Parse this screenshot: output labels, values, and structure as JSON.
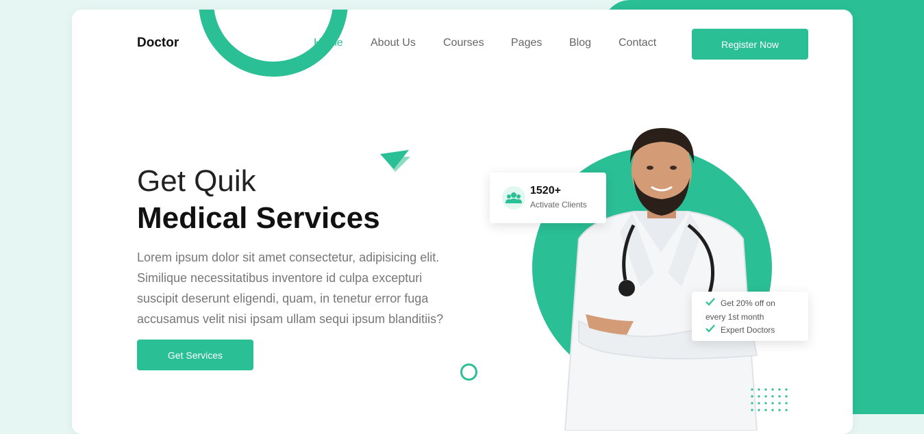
{
  "brand": {
    "logo": "Doctor",
    "accent": "#2bbf96"
  },
  "nav": {
    "items": [
      {
        "label": "Home",
        "active": true
      },
      {
        "label": "About Us",
        "active": false
      },
      {
        "label": "Courses",
        "active": false
      },
      {
        "label": "Pages",
        "active": false
      },
      {
        "label": "Blog",
        "active": false
      },
      {
        "label": "Contact",
        "active": false
      }
    ],
    "register_label": "Register Now"
  },
  "hero": {
    "title_line1": "Get Quik",
    "title_line2": "Medical Services",
    "description": "Lorem ipsum dolor sit amet consectetur, adipisicing elit. Similique necessitatibus inventore id culpa excepturi suscipit deserunt eligendi, quam, in tenetur error fuga accusamus velit nisi ipsam ullam sequi ipsum blanditiis?",
    "cta_label": "Get Services"
  },
  "stat": {
    "icon": "users-icon",
    "value": "1520+",
    "label": "Activate Clients"
  },
  "offer": {
    "line1": "Get 20% off on",
    "line2": "every 1st month",
    "line3": "Expert Doctors",
    "icon": "check-icon"
  }
}
